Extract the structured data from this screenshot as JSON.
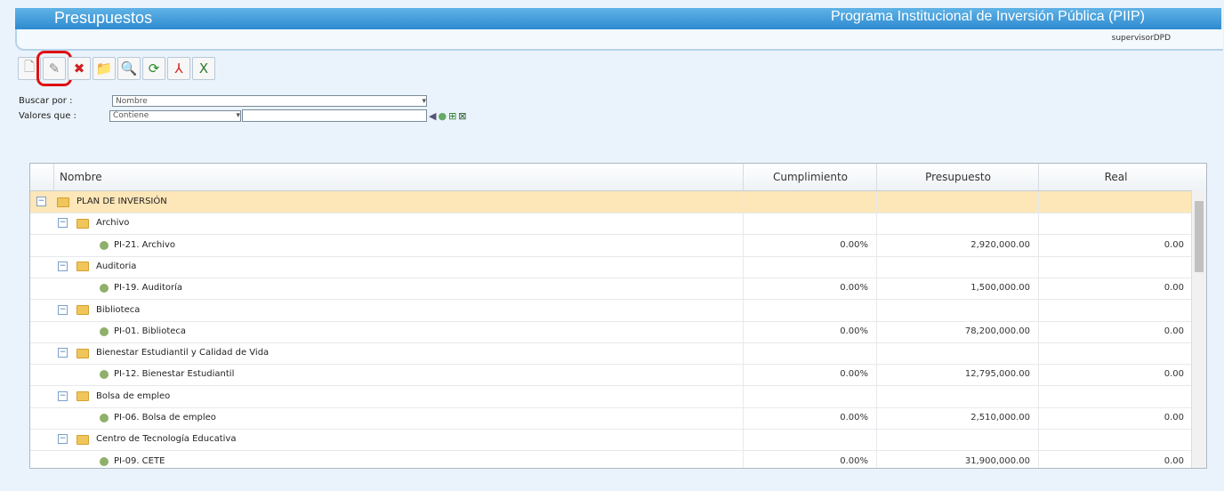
{
  "header": {
    "title": "Presupuestos",
    "program": "Programa Institucional de Inversión Pública (PIIP)",
    "user": "supervisorDPD"
  },
  "toolbar": [
    {
      "name": "new-icon",
      "glyph": "🗋"
    },
    {
      "name": "edit-icon",
      "glyph": "✎"
    },
    {
      "name": "delete-icon",
      "glyph": "✖"
    },
    {
      "name": "folder-icon",
      "glyph": "📁"
    },
    {
      "name": "preview-icon",
      "glyph": "🔍"
    },
    {
      "name": "refresh-icon",
      "glyph": "⟳"
    },
    {
      "name": "pdf-icon",
      "glyph": "⅄"
    },
    {
      "name": "excel-icon",
      "glyph": "X"
    }
  ],
  "search": {
    "by_label": "Buscar por :",
    "by_value": "Nombre",
    "values_label": "Valores que :",
    "values_value": "Contiene",
    "text_value": ""
  },
  "grid": {
    "columns": [
      "Nombre",
      "Cumplimiento",
      "Presupuesto",
      "Real"
    ],
    "rows": [
      {
        "level": 0,
        "type": "root",
        "name": "PLAN DE INVERSIÓN",
        "cumplimiento": "",
        "presupuesto": "",
        "real": ""
      },
      {
        "level": 1,
        "type": "group",
        "name": "Archivo",
        "cumplimiento": "",
        "presupuesto": "",
        "real": ""
      },
      {
        "level": 2,
        "type": "leaf",
        "name": "PI-21. Archivo",
        "cumplimiento": "0.00%",
        "presupuesto": "2,920,000.00",
        "real": "0.00"
      },
      {
        "level": 1,
        "type": "group",
        "name": "Auditoria",
        "cumplimiento": "",
        "presupuesto": "",
        "real": ""
      },
      {
        "level": 2,
        "type": "leaf",
        "name": "PI-19. Auditoría",
        "cumplimiento": "0.00%",
        "presupuesto": "1,500,000.00",
        "real": "0.00"
      },
      {
        "level": 1,
        "type": "group",
        "name": "Biblioteca",
        "cumplimiento": "",
        "presupuesto": "",
        "real": ""
      },
      {
        "level": 2,
        "type": "leaf",
        "name": "PI-01. Biblioteca",
        "cumplimiento": "0.00%",
        "presupuesto": "78,200,000.00",
        "real": "0.00"
      },
      {
        "level": 1,
        "type": "group",
        "name": "Bienestar Estudiantil y Calidad de Vida",
        "cumplimiento": "",
        "presupuesto": "",
        "real": ""
      },
      {
        "level": 2,
        "type": "leaf",
        "name": "PI-12. Bienestar Estudiantil",
        "cumplimiento": "0.00%",
        "presupuesto": "12,795,000.00",
        "real": "0.00"
      },
      {
        "level": 1,
        "type": "group",
        "name": "Bolsa de empleo",
        "cumplimiento": "",
        "presupuesto": "",
        "real": ""
      },
      {
        "level": 2,
        "type": "leaf",
        "name": "PI-06. Bolsa de empleo",
        "cumplimiento": "0.00%",
        "presupuesto": "2,510,000.00",
        "real": "0.00"
      },
      {
        "level": 1,
        "type": "group",
        "name": "Centro de Tecnología Educativa",
        "cumplimiento": "",
        "presupuesto": "",
        "real": ""
      },
      {
        "level": 2,
        "type": "leaf",
        "name": "PI-09. CETE",
        "cumplimiento": "0.00%",
        "presupuesto": "31,900,000.00",
        "real": "0.00"
      }
    ]
  }
}
